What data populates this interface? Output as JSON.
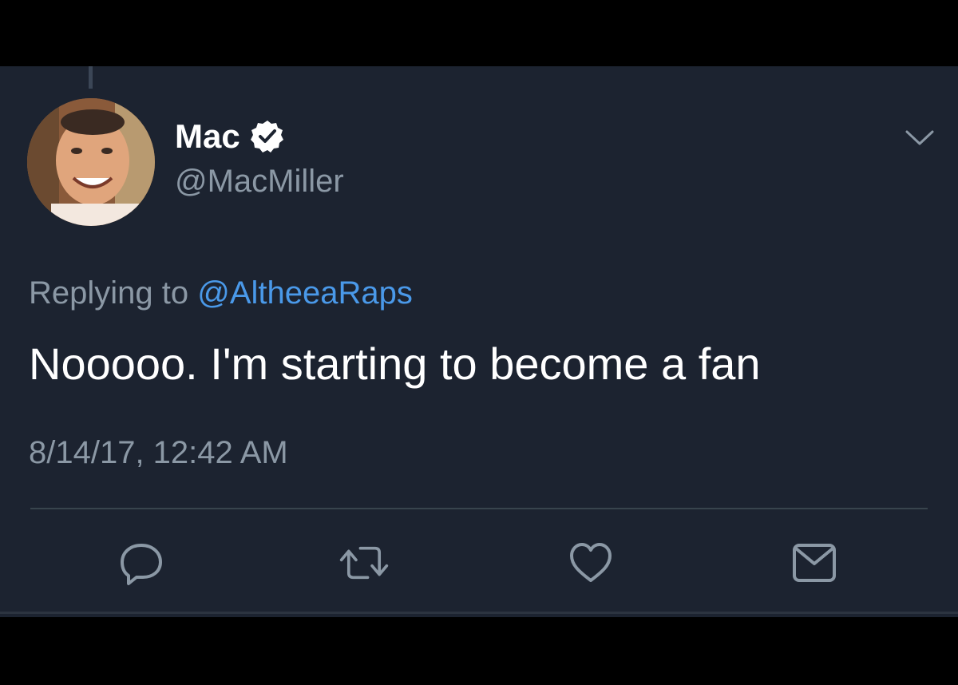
{
  "author": {
    "display_name": "Mac",
    "handle": "@MacMiller",
    "verified": true
  },
  "reply": {
    "prefix": "Replying to",
    "mention": "@AltheeaRaps"
  },
  "tweet": {
    "text": "Nooooo. I'm starting to become a fan",
    "timestamp": "8/14/17, 12:42 AM"
  },
  "actions": [
    "reply-icon",
    "retweet-icon",
    "like-icon",
    "message-icon"
  ],
  "colors": {
    "background": "#1c2330",
    "text_primary": "#ffffff",
    "text_secondary": "#8b98a5",
    "link": "#4a99e9"
  }
}
